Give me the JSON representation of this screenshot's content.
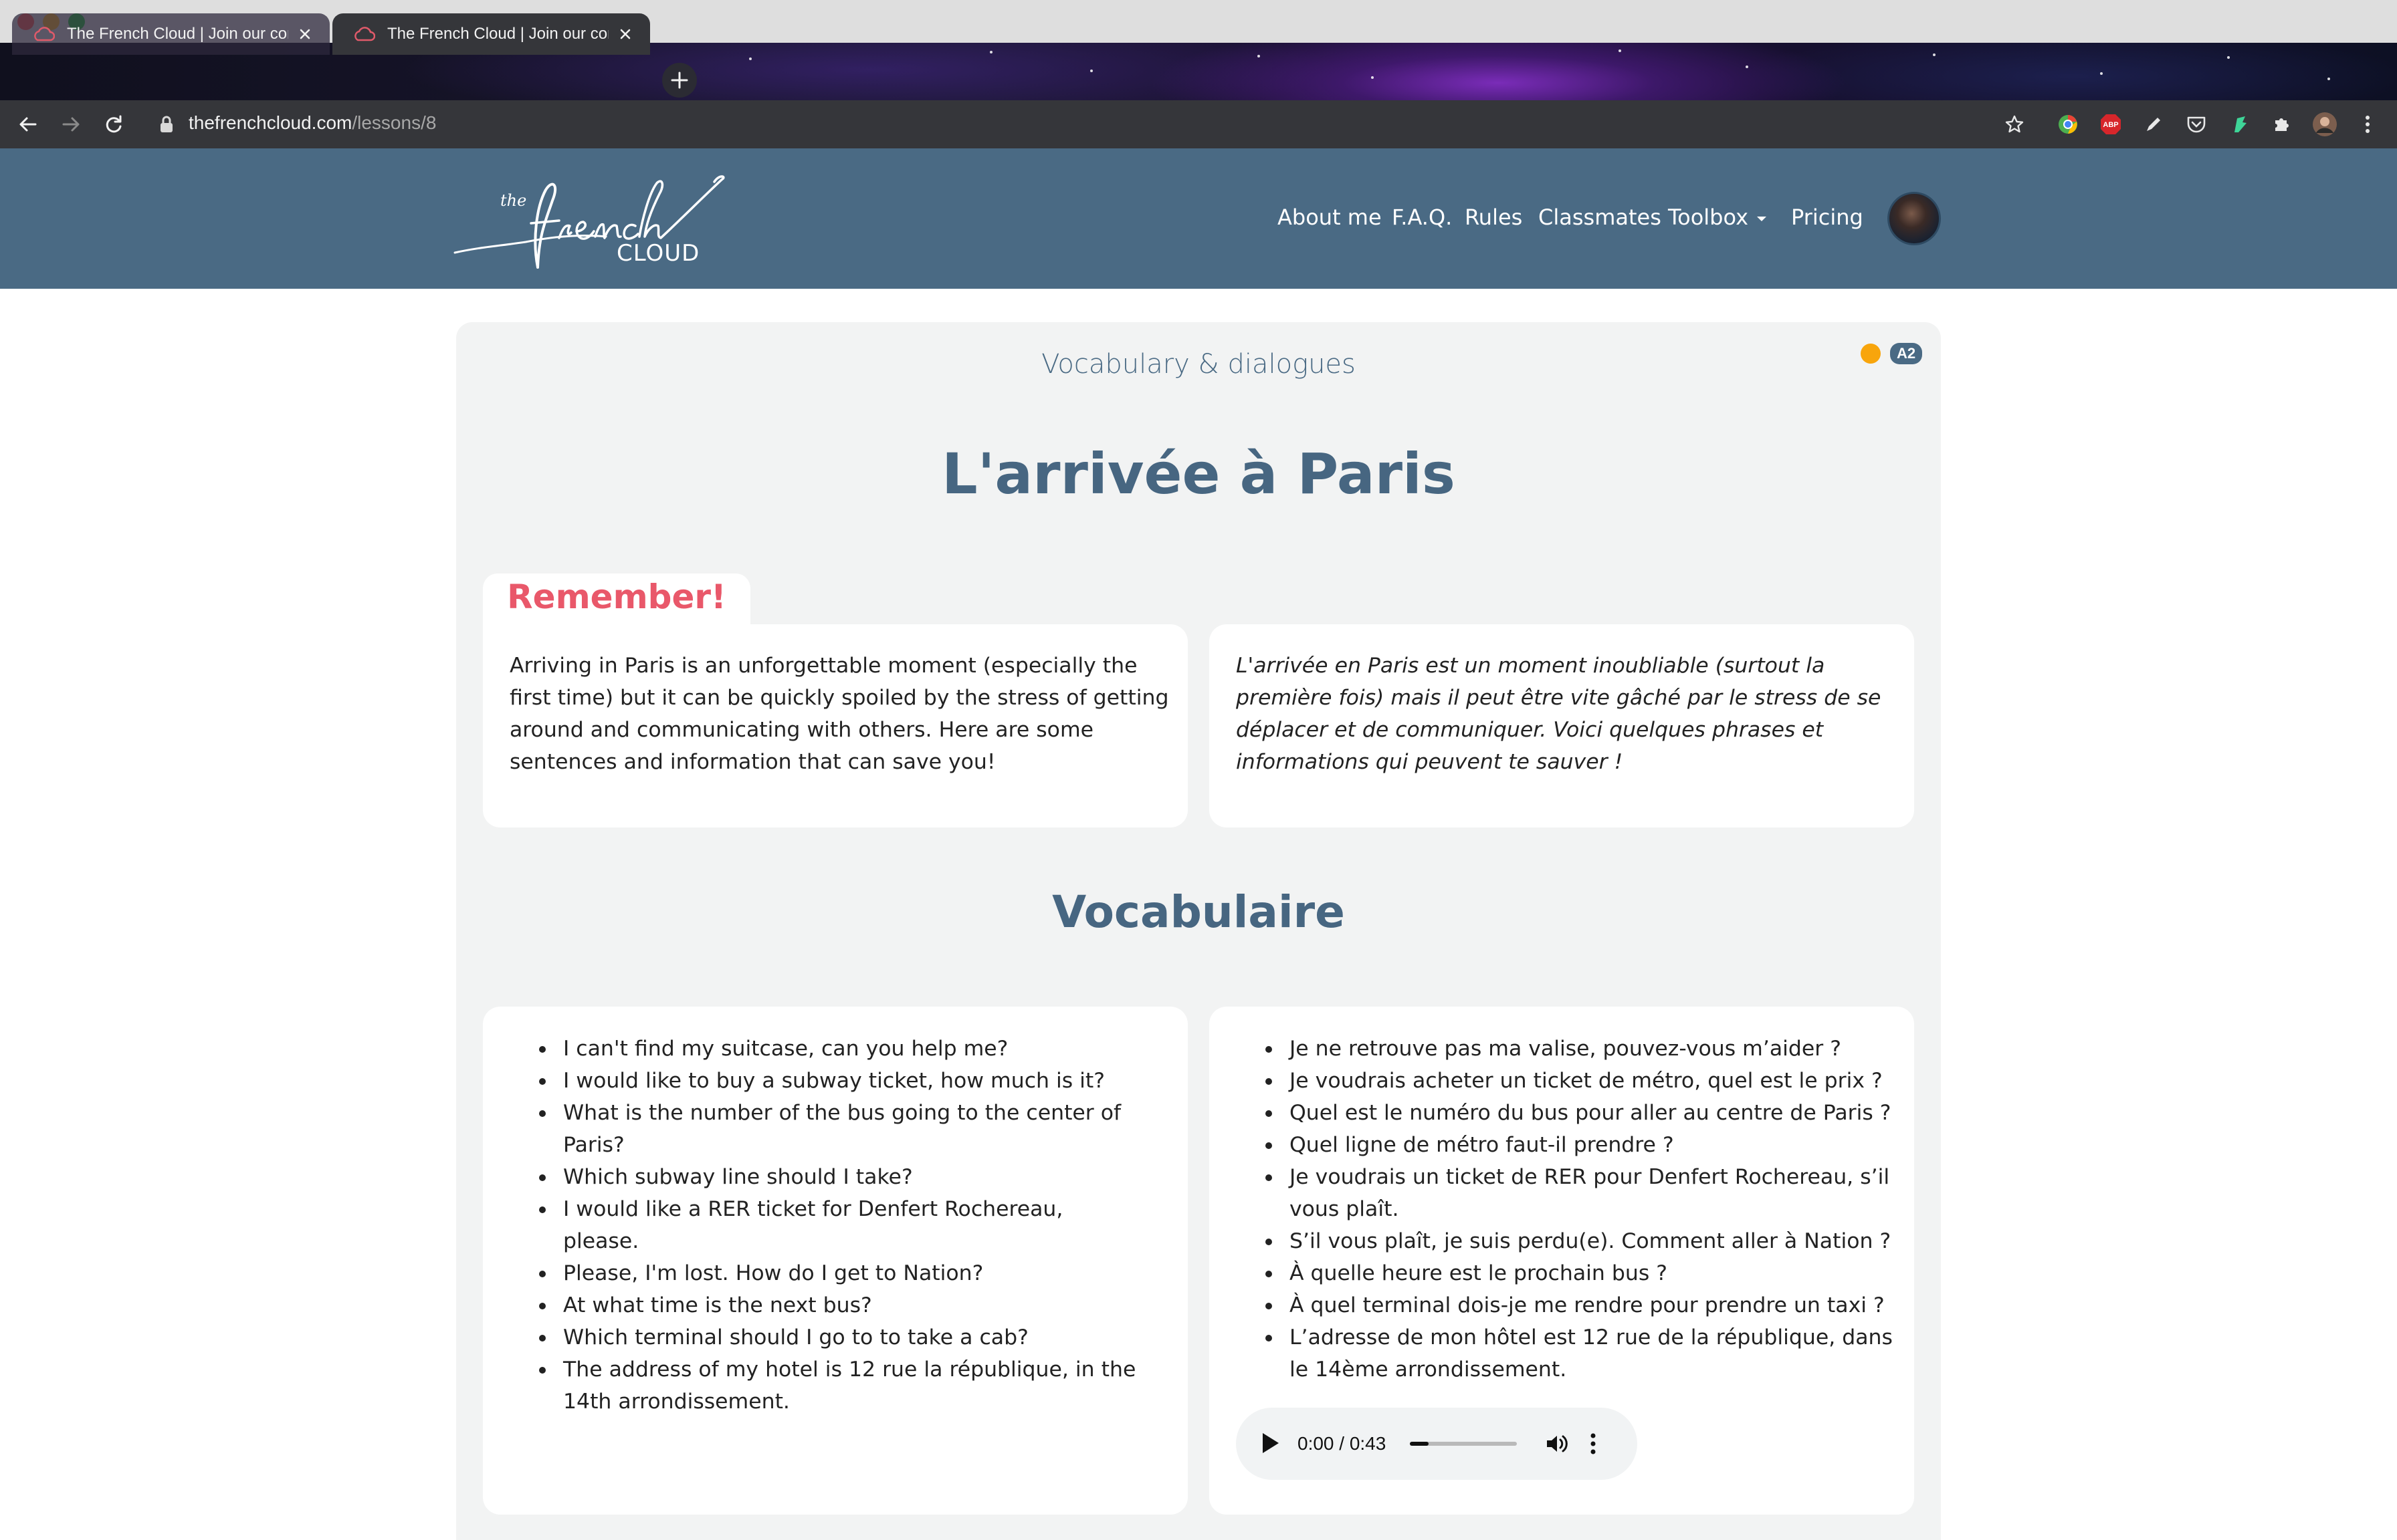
{
  "browser": {
    "tabs": [
      {
        "title": "The French Cloud | Join our community",
        "active": false
      },
      {
        "title": "The French Cloud | Join our community",
        "active": true
      }
    ],
    "url_domain": "thefrenchcloud.com",
    "url_path": "/lessons/8"
  },
  "site": {
    "nav": [
      {
        "label": "About me"
      },
      {
        "label": "F.A.Q."
      },
      {
        "label": "Rules"
      },
      {
        "label": "Classmates"
      },
      {
        "label": "Toolbox"
      },
      {
        "label": "Pricing"
      }
    ],
    "accent_color": "#4a6a84"
  },
  "lesson": {
    "kicker": "Vocabulary & dialogues",
    "level": "A2",
    "status_color": "#f8a50c",
    "title": "L'arrivée à Paris",
    "remember_label": "Remember!",
    "intro_en": "Arriving in Paris is an unforgettable moment (especially the first time) but it can be quickly spoiled by the stress of getting around and communicating with others. Here are some sentences and information that can save you!",
    "intro_fr": "L'arrivée en Paris est un moment inoubliable (surtout la première fois) mais il peut être vite gâché par le stress de se déplacer et de communiquer. Voici quelques phrases et informations qui peuvent te sauver !",
    "vocab_title": "Vocabulaire",
    "vocab_en": [
      "I can't find my suitcase, can you help me?",
      "I would like to buy a subway ticket, how much is it?",
      "What is the number of the bus going to the center of Paris?",
      "Which subway line should I take?",
      "I would like a RER ticket for Denfert Rochereau, please.",
      "Please, I'm lost. How do I get to Nation?",
      "At what time is the next bus?",
      "Which terminal should I go to to take a cab?",
      "The address of my hotel is 12 rue la république, in the 14th arrondissement."
    ],
    "vocab_fr": [
      "Je ne retrouve pas ma valise, pouvez-vous m’aider ?",
      "Je voudrais acheter un ticket de métro, quel est le prix ?",
      "Quel est le numéro du bus pour aller au centre de Paris ?",
      "Quel ligne de métro faut-il prendre ?",
      "Je voudrais un ticket de RER pour Denfert Rochereau, s’il vous plaît.",
      "S’il vous plaît, je suis perdu(e). Comment aller à Nation ?",
      "À quelle heure est le prochain bus ?",
      "À quel terminal dois-je me rendre pour prendre un taxi ?",
      "L’adresse de mon hôtel est 12 rue de la république, dans le 14ème arrondissement."
    ],
    "audio": {
      "time": "0:00 / 0:43",
      "progress": 0.0
    }
  }
}
